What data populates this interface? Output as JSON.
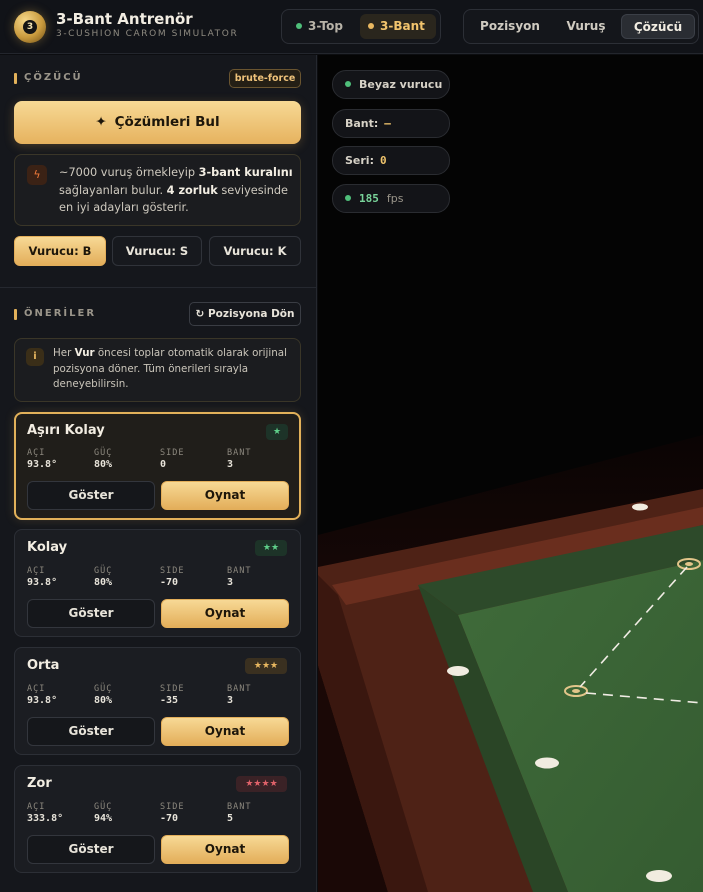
{
  "header": {
    "logo_ball_number": "3",
    "title": "3-Bant Antrenör",
    "subtitle": "3-CUSHION CAROM SIMULATOR",
    "modes": [
      {
        "label": "3-Top",
        "dot_color": "#4fbf7a",
        "active": false
      },
      {
        "label": "3-Bant",
        "dot_color": "#e9b860",
        "active": true
      }
    ],
    "nav": [
      {
        "label": "Pozisyon",
        "active": false
      },
      {
        "label": "Vuruş",
        "active": false
      },
      {
        "label": "Çözücü",
        "active": true
      }
    ]
  },
  "solver": {
    "section_label": "ÇÖZÜCÜ",
    "badge": "brute-force",
    "find_button": "Çözümleri Bul",
    "find_icon": "sparkle-icon",
    "info": {
      "icon": "lightning-icon",
      "p1": "~7000 vuruş örnekleyip ",
      "b1": "3-bant kuralını",
      "p2": " sağlayanları bulur. ",
      "b2": "4 zorluk",
      "p3": " seviyesinde en iyi adayları gösterir."
    },
    "cue_options": [
      {
        "label": "Vurucu: B",
        "active": true
      },
      {
        "label": "Vurucu: S",
        "active": false
      },
      {
        "label": "Vurucu: K",
        "active": false
      }
    ]
  },
  "suggestions": {
    "section_label": "ÖNERİLER",
    "back_button": "↻ Pozisyona Dön",
    "tip": {
      "icon": "i",
      "p1": "Her ",
      "b1": "Vur",
      "p2": " öncesi toplar otomatik olarak orijinal pozisyona döner. Tüm önerileri sırayla deneyebilirsin."
    },
    "stat_labels": {
      "angle": "AÇI",
      "power": "GÜÇ",
      "side": "SIDE",
      "cushion": "BANT"
    },
    "show_label": "Göster",
    "play_label": "Oynat",
    "cards": [
      {
        "title": "Aşırı Kolay",
        "stars": "★",
        "star_color": "#5fd08a",
        "star_bg": "#1d3328",
        "angle": "93.8°",
        "power": "80%",
        "side": "0",
        "cushion": "3",
        "active": true
      },
      {
        "title": "Kolay",
        "stars": "★★",
        "star_color": "#5fd08a",
        "star_bg": "#1d3328",
        "angle": "93.8°",
        "power": "80%",
        "side": "-70",
        "cushion": "3",
        "active": false
      },
      {
        "title": "Orta",
        "stars": "★★★",
        "star_color": "#e9b860",
        "star_bg": "#3a3020",
        "angle": "93.8°",
        "power": "80%",
        "side": "-35",
        "cushion": "3",
        "active": false
      },
      {
        "title": "Zor",
        "stars": "★★★★",
        "star_color": "#e0626a",
        "star_bg": "#3a2226",
        "angle": "333.8°",
        "power": "94%",
        "side": "-70",
        "cushion": "5",
        "active": false
      }
    ]
  },
  "hud": {
    "cue_label": "Beyaz vurucu",
    "cue_dot_color": "#4fbf7a",
    "bant_label": "Bant:",
    "bant_value": "—",
    "seri_label": "Seri:",
    "seri_value": "0",
    "fps_value": "185",
    "fps_unit": "fps",
    "fps_dot_color": "#4fbf7a"
  },
  "colors": {
    "accent": "#e2b15a",
    "felt": "#3e6a3a",
    "rail": "#5a2a1c",
    "floor": "#3a140e"
  }
}
